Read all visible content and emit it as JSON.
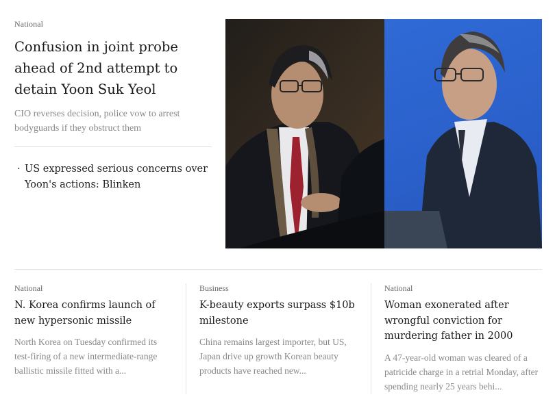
{
  "lead": {
    "section": "National",
    "headline": "Confusion in joint probe ahead of 2nd attempt to detain Yoon Suk Yeol",
    "deck": "CIO reverses decision, police vow to arrest bodyguards if they obstruct them",
    "related": "US expressed serious concerns over Yoon's actions: Blinken"
  },
  "stories": [
    {
      "section": "National",
      "headline": "N. Korea confirms launch of new hypersonic missile",
      "deck": "North Korea on Tuesday confirmed its test-firing of a new intermediate-range ballistic missile fitted with a..."
    },
    {
      "section": "Business",
      "headline": "K-beauty exports surpass $10b milestone",
      "deck": "China remains largest importer, but US, Japan drive up growth Korean beauty products have reached new..."
    },
    {
      "section": "National",
      "headline": "Woman exonerated after wrongful conviction for murdering father in 2000",
      "deck": "A 47-year-old woman was cleared of a patricide charge in a retrial Monday, after spending nearly 25 years behi..."
    }
  ],
  "colors": {
    "photo_right_bg": "#2f6ad6",
    "text_muted": "#888888"
  }
}
